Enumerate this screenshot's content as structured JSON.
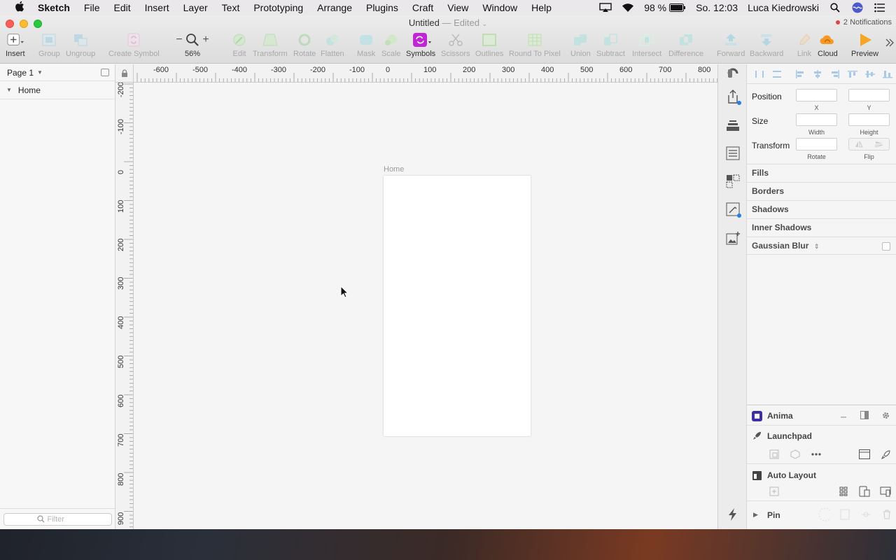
{
  "menubar": {
    "app_name": "Sketch",
    "items": [
      "File",
      "Edit",
      "Insert",
      "Layer",
      "Text",
      "Prototyping",
      "Arrange",
      "Plugins",
      "Craft",
      "View",
      "Window",
      "Help"
    ],
    "battery": "98 %",
    "clock": "So. 12:03",
    "user": "Luca Kiedrowski"
  },
  "window": {
    "title": "Untitled",
    "title_suffix": "— Edited",
    "notifications": "2 Notifications"
  },
  "toolbar": {
    "insert": "Insert",
    "group": "Group",
    "ungroup": "Ungroup",
    "create_symbol": "Create Symbol",
    "zoom": "56%",
    "edit": "Edit",
    "transform": "Transform",
    "rotate": "Rotate",
    "flatten": "Flatten",
    "mask": "Mask",
    "scale": "Scale",
    "symbols": "Symbols",
    "scissors": "Scissors",
    "outlines": "Outlines",
    "round_to_pixel": "Round To Pixel",
    "union": "Union",
    "subtract": "Subtract",
    "intersect": "Intersect",
    "difference": "Difference",
    "forward": "Forward",
    "backward": "Backward",
    "link": "Link",
    "cloud": "Cloud",
    "preview": "Preview"
  },
  "layers": {
    "page": "Page 1",
    "items": [
      "Home"
    ],
    "filter_placeholder": "Filter"
  },
  "rulers": {
    "horizontal": [
      "-600",
      "-500",
      "-400",
      "-300",
      "-200",
      "-100",
      "0",
      "100",
      "200",
      "300",
      "400",
      "500",
      "600",
      "700",
      "800"
    ],
    "vertical": [
      "-200",
      "-100",
      "0",
      "100",
      "200",
      "300",
      "400",
      "500",
      "600",
      "700",
      "800",
      "900"
    ]
  },
  "canvas": {
    "artboard_name": "Home"
  },
  "inspector": {
    "position_label": "Position",
    "x_label": "X",
    "y_label": "Y",
    "size_label": "Size",
    "width_label": "Width",
    "height_label": "Height",
    "transform_label": "Transform",
    "rotate_label": "Rotate",
    "flip_label": "Flip",
    "sections": [
      "Fills",
      "Borders",
      "Shadows",
      "Inner Shadows",
      "Gaussian Blur"
    ]
  },
  "plugins": {
    "anima": "Anima",
    "launchpad": "Launchpad",
    "auto_layout": "Auto Layout",
    "pin": "Pin"
  },
  "colors": {
    "symbols_accent": "#c026d3",
    "notification_dot": "#e04545",
    "selection_blue": "#2b7de9"
  }
}
